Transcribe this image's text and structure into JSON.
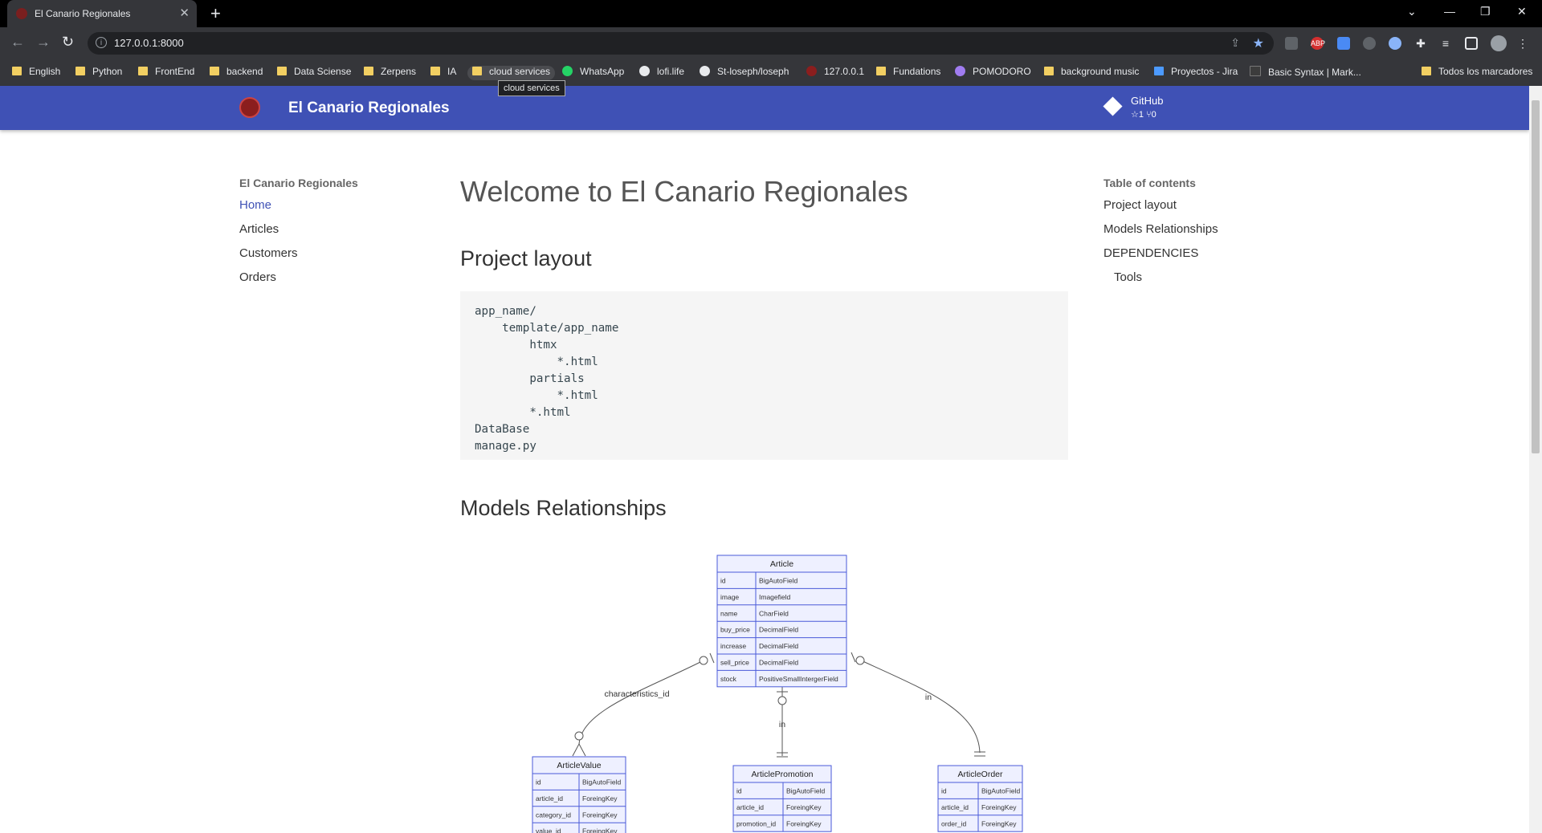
{
  "browser": {
    "tab_title": "El Canario Regionales",
    "tab_close": "✕",
    "new_tab": "+",
    "url": "127.0.0.1:8000",
    "tooltip": "cloud services",
    "bookmarks": [
      "English",
      "Python",
      "FrontEnd",
      "backend",
      "Data Sciense",
      "Zerpens",
      "IA",
      "cloud services",
      "WhatsApp",
      "lofi.life",
      "St-loseph/loseph",
      "127.0.0.1",
      "Fundations",
      "POMODORO",
      "background music",
      "Proyectos - Jira",
      "Basic Syntax | Mark...",
      "Todos los marcadores"
    ],
    "extensions": [
      "ABP"
    ]
  },
  "site": {
    "title": "El Canario Regionales",
    "github_label": "GitHub",
    "github_stats": "☆1  ⑂0"
  },
  "leftnav": {
    "title": "El Canario Regionales",
    "items": [
      "Home",
      "Articles",
      "Customers",
      "Orders"
    ]
  },
  "main": {
    "page_title": "Welcome to El Canario Regionales",
    "section1": "Project layout",
    "code": "app_name/\n    template/app_name\n        htmx\n            *.html\n        partials\n            *.html\n        *.html\nDataBase\nmanage.py",
    "section2": "Models Relationships"
  },
  "toc": {
    "title": "Table of contents",
    "items": [
      "Project layout",
      "Models Relationships",
      "DEPENDENCIES",
      "Tools"
    ]
  },
  "diagram": {
    "entities": [
      {
        "name": "Article",
        "rows": [
          [
            "id",
            "BigAutoField"
          ],
          [
            "image",
            "Imagefield"
          ],
          [
            "name",
            "CharField"
          ],
          [
            "buy_price",
            "DecimalField"
          ],
          [
            "increase",
            "DecimalField"
          ],
          [
            "sell_price",
            "DecimalField"
          ],
          [
            "stock",
            "PositiveSmallIntergerField"
          ]
        ]
      },
      {
        "name": "ArticleValue",
        "rows": [
          [
            "id",
            "BigAutoField"
          ],
          [
            "article_id",
            "ForeingKey"
          ],
          [
            "category_id",
            "ForeingKey"
          ],
          [
            "value_id",
            "ForeingKey"
          ]
        ]
      },
      {
        "name": "ArticlePromotion",
        "rows": [
          [
            "id",
            "BigAutoField"
          ],
          [
            "article_id",
            "ForeingKey"
          ],
          [
            "promotion_id",
            "ForeingKey"
          ]
        ]
      },
      {
        "name": "ArticleOrder",
        "rows": [
          [
            "id",
            "BigAutoField"
          ],
          [
            "article_id",
            "ForeingKey"
          ],
          [
            "order_id",
            "ForeingKey"
          ]
        ]
      }
    ],
    "relations": [
      "characteristics_id",
      "in",
      "in"
    ]
  }
}
